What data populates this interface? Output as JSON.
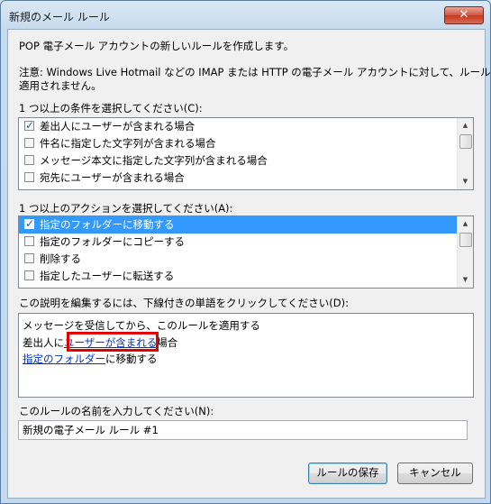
{
  "window": {
    "title": "新規のメール ルール",
    "close_label": "✕"
  },
  "intro_text": "POP 電子メール アカウントの新しいルールを作成します。",
  "note_line1": "注意: Windows Live Hotmail などの IMAP または HTTP の電子メール アカウントに対して、ルールは",
  "note_line2": "適用されません。",
  "conditions": {
    "label": "1 つ以上の条件を選択してください(C):",
    "items": [
      {
        "label": "差出人にユーザーが含まれる場合",
        "checked": true
      },
      {
        "label": "件名に指定した文字列が含まれる場合",
        "checked": false
      },
      {
        "label": "メッセージ本文に指定した文字列が含まれる場合",
        "checked": false
      },
      {
        "label": "宛先にユーザーが含まれる場合",
        "checked": false
      }
    ]
  },
  "actions": {
    "label": "1 つ以上のアクションを選択してください(A):",
    "items": [
      {
        "label": "指定のフォルダーに移動する",
        "checked": true,
        "selected": true
      },
      {
        "label": "指定のフォルダーにコピーする",
        "checked": false
      },
      {
        "label": "削除する",
        "checked": false
      },
      {
        "label": "指定したユーザーに転送する",
        "checked": false
      }
    ]
  },
  "description": {
    "label": "この説明を編集するには、下線付きの単語をクリックしてください(D):",
    "line1": "メッセージを受信してから、このルールを適用する",
    "line2_prefix": "差出人に",
    "line2_link": "ユーザーが含まれる",
    "line2_suffix": "場合",
    "line3_link": "指定のフォルダー",
    "line3_suffix": "に移動する"
  },
  "rule_name": {
    "label": "このルールの名前を入力してください(N):",
    "value": "新規の電子メール ルール #1"
  },
  "buttons": {
    "save": "ルールの保存",
    "cancel": "キャンセル"
  },
  "colors": {
    "highlight_box": "#e10000",
    "selection": "#3399ff",
    "link": "#0033cc"
  }
}
